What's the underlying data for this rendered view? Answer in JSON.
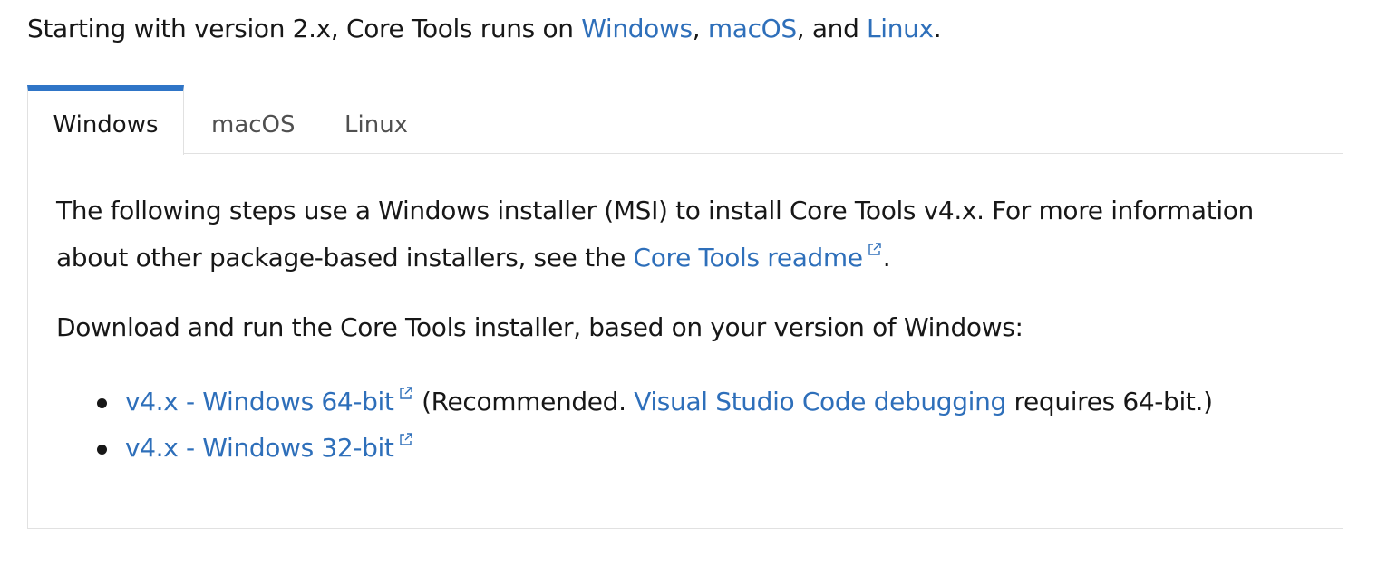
{
  "intro": {
    "prefix": "Starting with version 2.x, Core Tools runs on ",
    "windows_link": "Windows",
    "sep1": ", ",
    "macos_link": "macOS",
    "sep2": ", and ",
    "linux_link": "Linux",
    "suffix": "."
  },
  "tabs": [
    {
      "label": "Windows",
      "selected": true
    },
    {
      "label": "macOS",
      "selected": false
    },
    {
      "label": "Linux",
      "selected": false
    }
  ],
  "panel": {
    "para1_line1": "The following steps use a Windows installer (MSI) to install Core Tools v4.x. For more information",
    "para1_line2_prefix": "about other package-based installers, see the ",
    "readme_link": "Core Tools readme",
    "para1_line2_suffix": ".",
    "para2": "Download and run the Core Tools installer, based on your version of Windows:",
    "downloads": [
      {
        "link": "v4.x - Windows 64-bit",
        "note_prefix": " (Recommended. ",
        "note_link": "Visual Studio Code debugging",
        "note_suffix": " requires 64-bit.)"
      },
      {
        "link": "v4.x - Windows 32-bit"
      }
    ]
  },
  "colors": {
    "link": "#2e6fba",
    "active_tab_indicator": "#2f75c7",
    "border": "#e1e1e1",
    "text": "#171717"
  },
  "icons": {
    "external_link": "external-link-icon",
    "bullet": "bullet-icon"
  }
}
